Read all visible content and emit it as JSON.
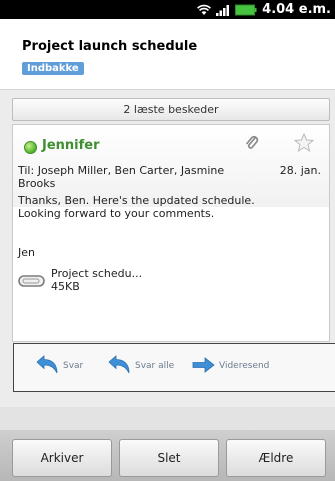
{
  "status_bar": {
    "time": "4.04 e.m.",
    "icons": [
      "wifi-icon",
      "signal-icon",
      "battery-icon"
    ]
  },
  "header": {
    "subject": "Project launch schedule",
    "folder": "Indbakke"
  },
  "thread": {
    "read_messages": "2 læste beskeder"
  },
  "message": {
    "sender": "Jennifer",
    "to_line": "Til: Joseph Miller, Ben Carter, Jasmine Brooks",
    "date": "28. jan.",
    "body_lines": [
      "Thanks, Ben. Here's the updated schedule.",
      "Looking forward to your comments."
    ],
    "signature": "Jen",
    "attachment": {
      "name": "Project schedu...",
      "size": "45KB"
    },
    "presence_color": "#4fb22b",
    "sender_color": "#3e8f2f"
  },
  "actions": {
    "reply": "Svar",
    "reply_all": "Svar alle",
    "forward": "Videresend"
  },
  "bottom_bar": {
    "archive": "Arkiver",
    "delete": "Slet",
    "older": "Ældre"
  },
  "colors": {
    "folder_label": "#5f9ed8",
    "action_icon": "#3f8fd6"
  }
}
